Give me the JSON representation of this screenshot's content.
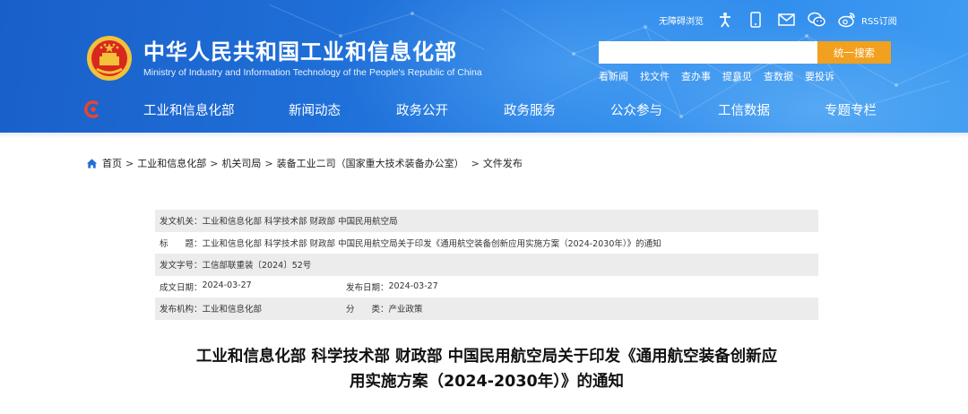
{
  "header": {
    "site_title": "中华人民共和国工业和信息化部",
    "site_subtitle": "Ministry of Industry and Information Technology of the People's Republic of China",
    "topbar": {
      "accessibility_label": "无障碍浏览",
      "rss_label": "RSS订阅",
      "icons": [
        "accessibility-icon",
        "mobile-icon",
        "mail-icon",
        "wechat-icon",
        "weibo-icon"
      ]
    },
    "search": {
      "placeholder": "",
      "button_label": "统一搜索"
    },
    "quick_links": [
      "看新闻",
      "找文件",
      "查办事",
      "提意见",
      "查数据",
      "要投诉"
    ],
    "nav_items": [
      "工业和信息化部",
      "新闻动态",
      "政务公开",
      "政务服务",
      "公众参与",
      "工信数据",
      "专题专栏"
    ],
    "colors": {
      "header_blue": "#1f6fd8",
      "search_button": "#f2a01f",
      "nav_icon": "#e8452c"
    }
  },
  "breadcrumb": {
    "items": [
      "首页",
      "工业和信息化部",
      "机关司局",
      "装备工业二司（国家重大技术装备办公室）",
      "文件发布"
    ],
    "separator": ">"
  },
  "info_table": {
    "issuer_label": "发文机关：",
    "issuer_value": "工业和信息化部 科学技术部 财政部 中国民用航空局",
    "title_label": "标　　题：",
    "title_value": "工业和信息化部 科学技术部 财政部 中国民用航空局关于印发《通用航空装备创新应用实施方案（2024-2030年）》的通知",
    "doc_no_label": "发文字号：",
    "doc_no_value": "工信部联重装〔2024〕52号",
    "created_label": "成文日期：",
    "created_value": "2024-03-27",
    "published_label": "发布日期：",
    "published_value": "2024-03-27",
    "org_label": "发布机构：",
    "org_value": "工业和信息化部",
    "category_label": "分　　类：",
    "category_value": "产业政策"
  },
  "document": {
    "title_line1": "工业和信息化部 科学技术部 财政部 中国民用航空局关于印发《通用航空装备创新应",
    "title_line2": "用实施方案（2024-2030年）》的通知"
  }
}
